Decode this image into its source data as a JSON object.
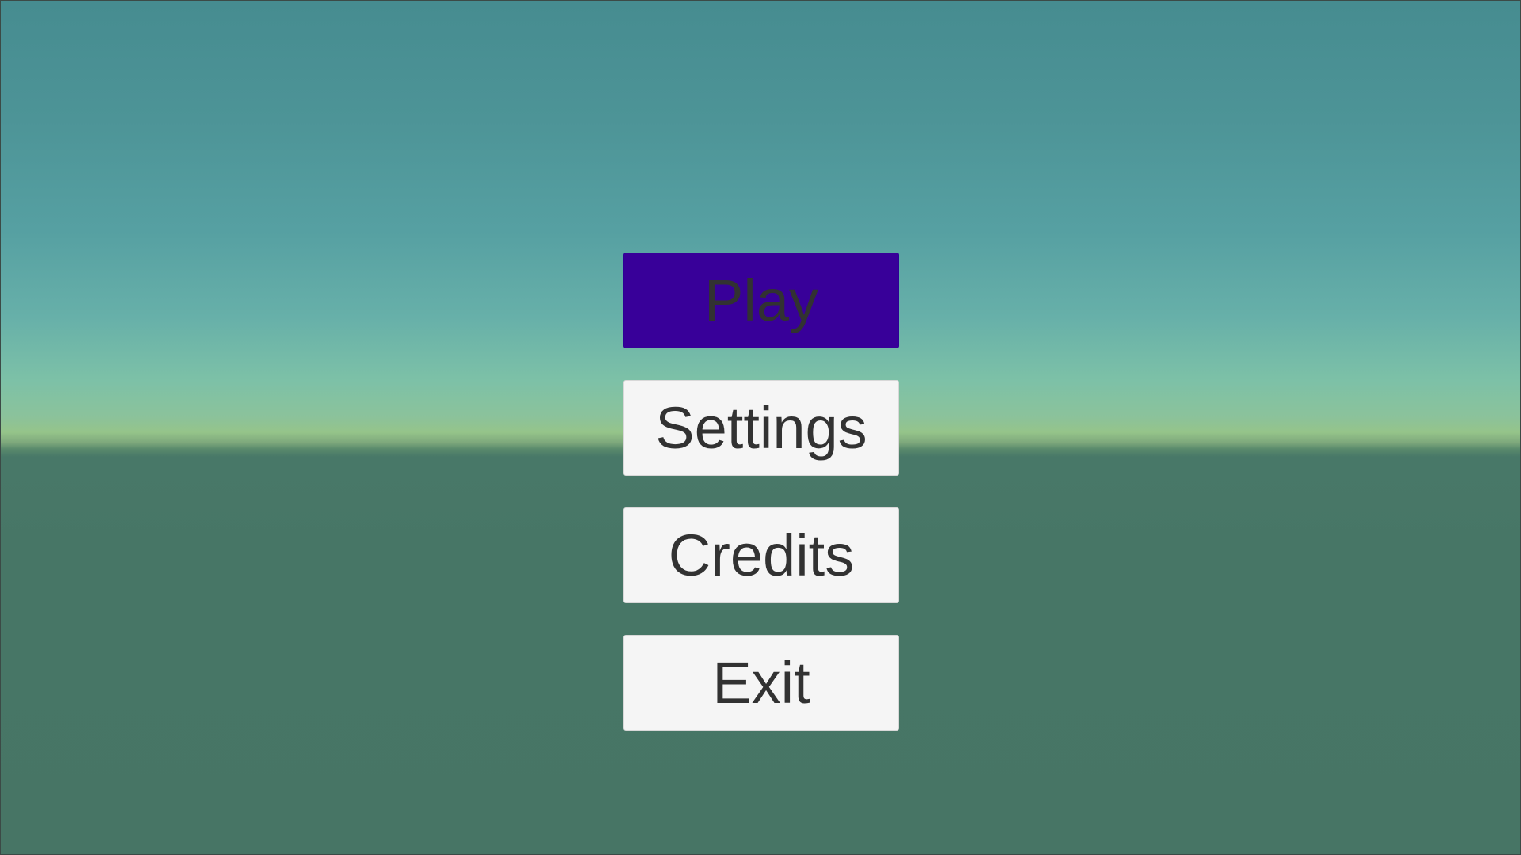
{
  "colors": {
    "sky_top": "#468c90",
    "horizon_glow": "#95c48a",
    "ground": "#477666",
    "button_bg": "#f5f5f5",
    "button_selected_bg": "#380099",
    "button_text": "#323232"
  },
  "main_menu": {
    "selected_index": 0,
    "buttons": [
      {
        "label": "Play"
      },
      {
        "label": "Settings"
      },
      {
        "label": "Credits"
      },
      {
        "label": "Exit"
      }
    ]
  }
}
